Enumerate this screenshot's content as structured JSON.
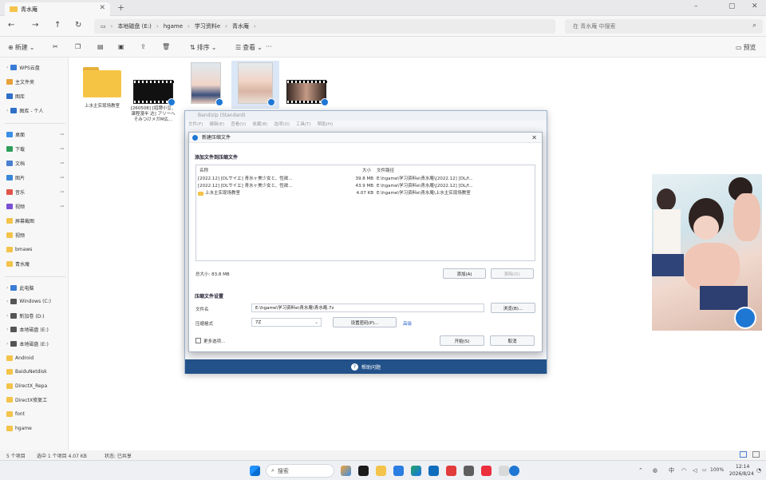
{
  "window": {
    "tab_title": "青水庵",
    "minimize": "–",
    "maximize": "▢",
    "close": "✕"
  },
  "address": {
    "crumbs": [
      "本地磁盘 (E:)",
      "hgame",
      "学习资料e",
      "青水庵"
    ],
    "search_placeholder": "在 青水庵 中搜索"
  },
  "toolbar": {
    "new_label": "新建",
    "sort_label": "排序",
    "view_label": "查看",
    "more_label": "···",
    "details_label": "预览"
  },
  "sidebar": {
    "top": [
      {
        "label": "WPS云盘",
        "color": "#3a7bd5"
      },
      {
        "label": "主文件夹",
        "color": "#e8a13a"
      },
      {
        "label": "图库",
        "color": "#2f6fc9"
      },
      {
        "label": "图库 - 个人",
        "color": "#2f6fc9"
      }
    ],
    "quick": [
      {
        "label": "桌面",
        "color": "#3a8ee6"
      },
      {
        "label": "下载",
        "color": "#2f9e5a"
      },
      {
        "label": "文档",
        "color": "#4a7fd1"
      },
      {
        "label": "图片",
        "color": "#3a86d8"
      },
      {
        "label": "音乐",
        "color": "#e2544a"
      },
      {
        "label": "视频",
        "color": "#7a4fd3"
      },
      {
        "label": "屏幕截图",
        "color": "#f4c34a"
      },
      {
        "label": "视频",
        "color": "#f4c34a"
      },
      {
        "label": "bmaws",
        "color": "#f4c34a"
      },
      {
        "label": "青水庵",
        "color": "#f4c34a"
      }
    ],
    "drives": [
      {
        "label": "此电脑",
        "color": "#3a7bd5"
      },
      {
        "label": "Windows (C:)",
        "color": "#555"
      },
      {
        "label": "新加卷 (D:)",
        "color": "#555"
      },
      {
        "label": "本地磁盘 (E:)",
        "color": "#555"
      },
      {
        "label": "本地磁盘 (E:)",
        "color": "#555"
      },
      {
        "label": "Android",
        "color": "#f4c34a"
      },
      {
        "label": "BaiduNetdisk",
        "color": "#f4c34a"
      },
      {
        "label": "DirectX_Repa",
        "color": "#f4c34a"
      },
      {
        "label": "DirectX修复工",
        "color": "#f4c34a"
      },
      {
        "label": "font",
        "color": "#f4c34a"
      },
      {
        "label": "hgame",
        "color": "#f4c34a"
      }
    ]
  },
  "files": [
    {
      "name": "上水主实现场教室"
    },
    {
      "name": "[260508] [招牌小豆、课程漫半 达] アリーへそみつけメガM広..."
    },
    {
      "name": ""
    },
    {
      "name": ""
    },
    {
      "name": ""
    }
  ],
  "bandizip": {
    "title": "Bandizip (Standard)",
    "menu": [
      "文件(F)",
      "编辑(E)",
      "查看(V)",
      "收藏(B)",
      "选项(O)",
      "工具(T)",
      "帮助(H)"
    ],
    "footer": "帮助问题"
  },
  "dialog": {
    "title": "新建压缩文件",
    "section_files": "添加文件到压缩文件",
    "columns": {
      "name": "名称",
      "size": "大小",
      "path": "文件路径"
    },
    "rows": [
      {
        "name": "[2022.12] [DLサイエ] 青水ヶ美少女と、性欲...",
        "size": "39.8 MB",
        "path": "E:\\hgame\\学习资料e\\青水庵\\[2022.12] [DL/f..."
      },
      {
        "name": "[2022.12] [DLサイエ] 青水ヶ美少女と、性欲...",
        "size": "43.9 MB",
        "path": "E:\\hgame\\学习资料e\\青水庵\\[2022.12] [DL/f..."
      },
      {
        "name": "上水主实现场教室",
        "size": "4.07 KB",
        "path": "E:\\hgame\\学习资料e\\青水庵\\上水主实现场教室"
      }
    ],
    "total": "总大小: 83.8 MB",
    "add_button": "添加(A)",
    "remove_button": "删除(D)",
    "section_settings": "压缩文件设置",
    "filename_label": "文件名",
    "filename_value": "E:\\hgame\\学习资料e\\青水庵\\青水庵.7z",
    "browse_button": "浏览(B)...",
    "format_label": "压缩格式",
    "format_value": "7Z",
    "password_button": "设置密码(P)...",
    "advanced_link": "高级",
    "more_options": "更多选项...",
    "start_button": "开始(S)",
    "cancel_button": "取消"
  },
  "status": {
    "count": "5 个项目",
    "selected": "选中 1 个项目  4.07 KB",
    "state": "状态: 已共享"
  },
  "taskbar": {
    "search_label": "搜索",
    "tray_text": "中",
    "battery": "100%",
    "time": "12:14",
    "date": "2026/8/24"
  },
  "colors": {
    "accent": "#1f77d4",
    "bandizip_footer": "#23528a",
    "folder": "#f4c34a"
  }
}
